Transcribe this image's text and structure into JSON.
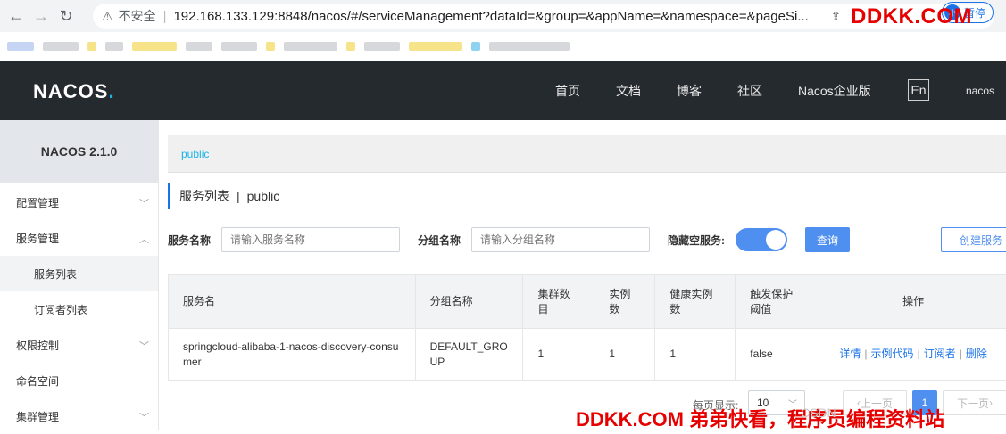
{
  "browser": {
    "insecure_label": "不安全",
    "url": "192.168.133.129:8848/nacos/#/serviceManagement?dataId=&group=&appName=&namespace=&pageSi...",
    "profile_initial": "小",
    "profile_name": "暂停"
  },
  "watermark": {
    "top": "DDKK.COM",
    "bottom": "DDKK.COM 弟弟快看，程序员编程资料站",
    "csdn": "CSDN"
  },
  "header": {
    "logo": "NACOS",
    "menu": [
      "首页",
      "文档",
      "博客",
      "社区",
      "Nacos企业版"
    ],
    "lang": "En",
    "user": "nacos"
  },
  "sidebar": {
    "version": "NACOS 2.1.0",
    "items": [
      {
        "label": "配置管理"
      },
      {
        "label": "服务管理"
      },
      {
        "label": "服务列表"
      },
      {
        "label": "订阅者列表"
      },
      {
        "label": "权限控制"
      },
      {
        "label": "命名空间"
      },
      {
        "label": "集群管理"
      }
    ]
  },
  "main": {
    "namespace": "public",
    "title": "服务列表",
    "title_ns": "public",
    "filters": {
      "service_label": "服务名称",
      "service_placeholder": "请输入服务名称",
      "group_label": "分组名称",
      "group_placeholder": "请输入分组名称",
      "hide_empty_label": "隐藏空服务:",
      "query_button": "查询",
      "create_button": "创建服务"
    },
    "table": {
      "headers": [
        "服务名",
        "分组名称",
        "集群数目",
        "实例数",
        "健康实例数",
        "触发保护阈值",
        "操作"
      ],
      "rows": [
        {
          "service": "springcloud-alibaba-1-nacos-discovery-consumer",
          "group": "DEFAULT_GROUP",
          "clusters": "1",
          "instances": "1",
          "healthy": "1",
          "threshold": "false",
          "actions": [
            "详情",
            "示例代码",
            "订阅者",
            "删除"
          ]
        }
      ]
    },
    "pagination": {
      "per_page_label": "每页显示:",
      "per_page_value": "10",
      "prev": "上一页",
      "current": "1",
      "next": "下一页"
    }
  }
}
